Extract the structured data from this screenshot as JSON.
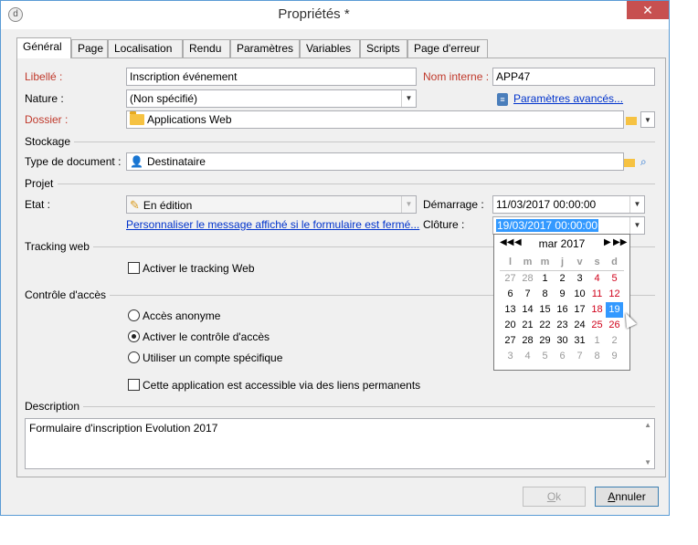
{
  "window": {
    "title": "Propriétés *",
    "close_glyph": "✕",
    "app_icon_glyph": "d"
  },
  "tabs": [
    "Général",
    "Page",
    "Localisation",
    "Rendu",
    "Paramètres",
    "Variables",
    "Scripts",
    "Page d'erreur"
  ],
  "general": {
    "libelle_label": "Libellé :",
    "libelle_value": "Inscription événement",
    "nom_interne_label": "Nom interne :",
    "nom_interne_value": "APP47",
    "nature_label": "Nature :",
    "nature_value": "(Non spécifié)",
    "params_link": "Paramètres avancés...",
    "dossier_label": "Dossier :",
    "dossier_value": "Applications Web"
  },
  "stockage": {
    "title": "Stockage",
    "type_label": "Type de document :",
    "type_value": "Destinataire"
  },
  "projet": {
    "title": "Projet",
    "etat_label": "Etat :",
    "etat_value": "En édition",
    "demarrage_label": "Démarrage :",
    "demarrage_value": "11/03/2017 00:00:00",
    "cloture_label": "Clôture :",
    "cloture_value": "19/03/2017 00:00:00",
    "custom_link": "Personnaliser le message affiché si le formulaire est fermé..."
  },
  "tracking": {
    "title": "Tracking web",
    "checkbox_label": "Activer le tracking Web"
  },
  "acces": {
    "title": "Contrôle d'accès",
    "radio1": "Accès anonyme",
    "radio2": "Activer le contrôle d'accès",
    "radio3": "Utiliser un compte spécifique",
    "permalink_label": "Cette application est accessible via des liens permanents"
  },
  "description": {
    "title": "Description",
    "value": "Formulaire d'inscription  Evolution 2017"
  },
  "buttons": {
    "ok_prefix": "O",
    "ok_rest": "k",
    "cancel_prefix": "A",
    "cancel_rest": "nnuler"
  },
  "calendar": {
    "month": "mar 2017",
    "nav_prev_year": "◀◀",
    "nav_prev": "◀",
    "nav_next": "▶",
    "nav_next_year": "▶▶",
    "days_of_week": [
      "l",
      "m",
      "m",
      "j",
      "v",
      "s",
      "d"
    ],
    "weeks": [
      [
        "27",
        "28",
        "1",
        "2",
        "3",
        "4",
        "5"
      ],
      [
        "6",
        "7",
        "8",
        "9",
        "10",
        "11",
        "12"
      ],
      [
        "13",
        "14",
        "15",
        "16",
        "17",
        "18",
        "19"
      ],
      [
        "20",
        "21",
        "22",
        "23",
        "24",
        "25",
        "26"
      ],
      [
        "27",
        "28",
        "29",
        "30",
        "31",
        "1",
        "2"
      ],
      [
        "3",
        "4",
        "5",
        "6",
        "7",
        "8",
        "9"
      ]
    ],
    "selected_day": "19",
    "colors": {
      "weekend": "#d0021b",
      "selected": "#3399ff",
      "other_month": "#999999"
    }
  },
  "icons": {
    "folder": "folder-icon",
    "person": "👤",
    "pencil": "✎",
    "clipboard": "clipboard-icon",
    "search": "⌕",
    "dropdown": "▼"
  }
}
